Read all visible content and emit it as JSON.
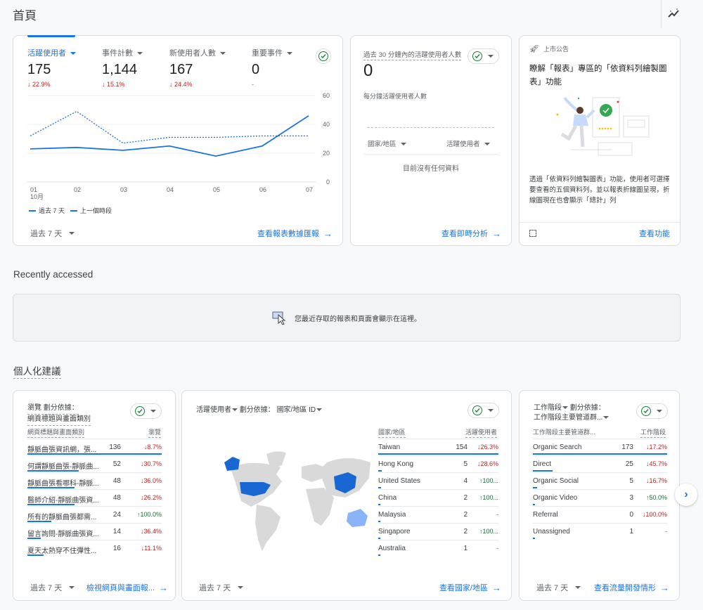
{
  "header": {
    "title": "首頁",
    "insights_icon": "insights-sparkline-icon"
  },
  "overview_card": {
    "metrics": [
      {
        "label": "活躍使用者",
        "value": "175",
        "delta": "22.9%",
        "direction": "down",
        "active": true
      },
      {
        "label": "事件計數",
        "value": "1,144",
        "delta": "15.1%",
        "direction": "down",
        "active": false
      },
      {
        "label": "新使用者人數",
        "value": "167",
        "delta": "24.4%",
        "direction": "down",
        "active": false
      },
      {
        "label": "重要事件",
        "value": "0",
        "delta": "-",
        "direction": "none",
        "active": false
      }
    ],
    "legend": {
      "current": "過去 7 天",
      "previous": "上一個時段"
    },
    "date_range": "過去 7 天",
    "link": "查看報表數據匯報",
    "month_label": "10月"
  },
  "chart_data": {
    "type": "line",
    "title": "",
    "xlabel": "",
    "ylabel": "",
    "categories": [
      "01",
      "02",
      "03",
      "04",
      "05",
      "06",
      "07"
    ],
    "x_sublabel": "10月",
    "ylim": [
      0,
      60
    ],
    "yticks": [
      0,
      20,
      40,
      60
    ],
    "grid": true,
    "legend_position": "bottom-left",
    "series": [
      {
        "name": "過去 7 天",
        "style": "solid",
        "values": [
          23,
          24,
          22,
          25,
          18,
          25,
          46
        ]
      },
      {
        "name": "上一個時段",
        "style": "dotted",
        "values": [
          32,
          49,
          27,
          31,
          31,
          32,
          32
        ]
      }
    ]
  },
  "realtime_card": {
    "title": "過去 30 分鐘內的活躍使用者人數",
    "value": "0",
    "subtitle": "每分鐘活躍使用者人數",
    "col_country": "國家/地區",
    "col_users": "活躍使用者",
    "empty": "目前沒有任何資料",
    "link": "查看即時分析"
  },
  "announcement_card": {
    "tag": "上市公告",
    "title": "瞭解「報表」專區的「依資料列繪製圖表」功能",
    "body": "透過「依資料列繪製圖表」功能，使用者可選擇要查看的五個資料列，並以報表折線圖呈現，折線圖現在也會顯示「總計」列",
    "link": "查看功能"
  },
  "recent": {
    "title": "Recently accessed",
    "message": "您最近存取的報表和頁面會顯示在這裡。"
  },
  "suggestions": {
    "title": "個人化建議",
    "pages_card": {
      "title_line1": "瀏覽 劃分依據：",
      "title_line2": "網頁標題與畫面類別",
      "col_name": "網頁標題與畫面類別",
      "col_value": "瀏覽",
      "rows": [
        {
          "name": "靜脈曲張資訊網，張...",
          "value": "136",
          "delta": "8.7%",
          "direction": "down",
          "share": 1.0
        },
        {
          "name": "何謂靜脈曲張-靜脈曲...",
          "value": "52",
          "delta": "30.7%",
          "direction": "down",
          "share": 0.38
        },
        {
          "name": "靜脈曲張看哪科-靜脈...",
          "value": "48",
          "delta": "36.0%",
          "direction": "down",
          "share": 0.35
        },
        {
          "name": "醫師介紹-靜脈曲張資...",
          "value": "48",
          "delta": "26.2%",
          "direction": "down",
          "share": 0.35
        },
        {
          "name": "所有的靜脈曲張都需...",
          "value": "24",
          "delta": "100.0%",
          "direction": "up",
          "share": 0.18
        },
        {
          "name": "留言詢問-靜脈曲張資...",
          "value": "14",
          "delta": "36.4%",
          "direction": "down",
          "share": 0.1
        },
        {
          "name": "夏天太熱穿不住彈性...",
          "value": "16",
          "delta": "11.1%",
          "direction": "down",
          "share": 0.12
        }
      ],
      "date_range": "過去 7 天",
      "link": "檢視網頁與畫面報..."
    },
    "country_card": {
      "title_metric": "活躍使用者",
      "title_by": "劃分依據：",
      "title_dim": "國家/地區 ID",
      "col_name": "國家/地區",
      "col_value": "活躍使用者",
      "rows": [
        {
          "name": "Taiwan",
          "value": "154",
          "delta": "26.3%",
          "direction": "down",
          "share": 1.0
        },
        {
          "name": "Hong Kong",
          "value": "5",
          "delta": "28.6%",
          "direction": "down",
          "share": 0.032
        },
        {
          "name": "United States",
          "value": "4",
          "delta": "100...",
          "direction": "up",
          "share": 0.026
        },
        {
          "name": "China",
          "value": "2",
          "delta": "100...",
          "direction": "up",
          "share": 0.013
        },
        {
          "name": "Malaysia",
          "value": "2",
          "delta": "-",
          "direction": "none",
          "share": 0.013
        },
        {
          "name": "Singapore",
          "value": "2",
          "delta": "100...",
          "direction": "up",
          "share": 0.013
        },
        {
          "name": "Australia",
          "value": "1",
          "delta": "-",
          "direction": "none",
          "share": 0.006
        }
      ],
      "highlighted_countries": [
        "United States",
        "China",
        "Australia"
      ],
      "date_range": "過去 7 天",
      "link": "查看國家/地區"
    },
    "channel_card": {
      "title_line1_metric": "工作階段",
      "title_line1_by": "劃分依據：",
      "title_line2": "工作階段主要管道群...",
      "col_name": "工作階段主要管道群...",
      "col_value": "工作階段",
      "rows": [
        {
          "name": "Organic Search",
          "value": "173",
          "delta": "17.2%",
          "direction": "down",
          "share": 1.0
        },
        {
          "name": "Direct",
          "value": "25",
          "delta": "45.7%",
          "direction": "down",
          "share": 0.145
        },
        {
          "name": "Organic Social",
          "value": "5",
          "delta": "16.7%",
          "direction": "down",
          "share": 0.03
        },
        {
          "name": "Organic Video",
          "value": "3",
          "delta": "50.0%",
          "direction": "up",
          "share": 0.018
        },
        {
          "name": "Referral",
          "value": "0",
          "delta": "100.0%",
          "direction": "down",
          "share": 0
        },
        {
          "name": "Unassigned",
          "value": "1",
          "delta": "-",
          "direction": "none",
          "share": 0.006
        }
      ],
      "date_range": "過去 7 天",
      "link": "查看流量開發情形"
    }
  }
}
